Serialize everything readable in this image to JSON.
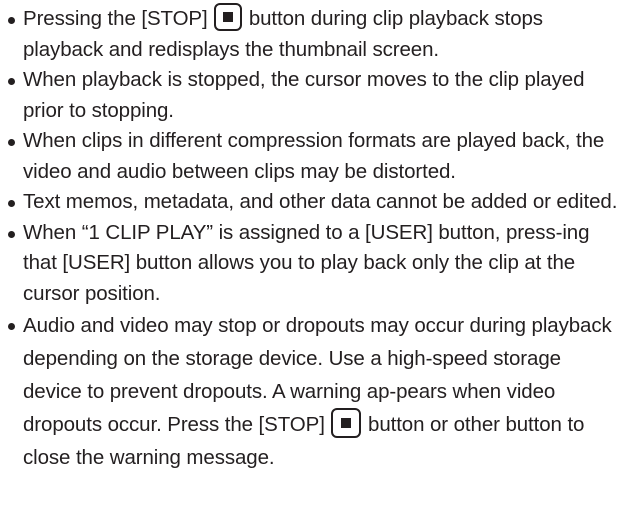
{
  "notes": [
    {
      "a": "Pressing the [STOP]",
      "b": "button during clip playback stops playback and redisplays the thumbnail screen."
    },
    {
      "text": "When playback is stopped, the cursor moves to the clip played prior to stopping."
    },
    {
      "text": "When clips in different compression formats are played back, the video and audio between clips may be distorted."
    },
    {
      "text": "Text memos, metadata, and other data cannot be added or edited."
    },
    {
      "text": "When “1 CLIP PLAY” is assigned to a [USER] button, press-ing that [USER] button allows you to play back only the clip at the cursor position."
    },
    {
      "a": "Audio and video may stop or dropouts may occur during playback depending on the storage device. Use a high-speed storage device to prevent dropouts. A warning ap-pears when video dropouts occur. Press the [STOP]",
      "b": "button or other button to close the warning message."
    }
  ]
}
